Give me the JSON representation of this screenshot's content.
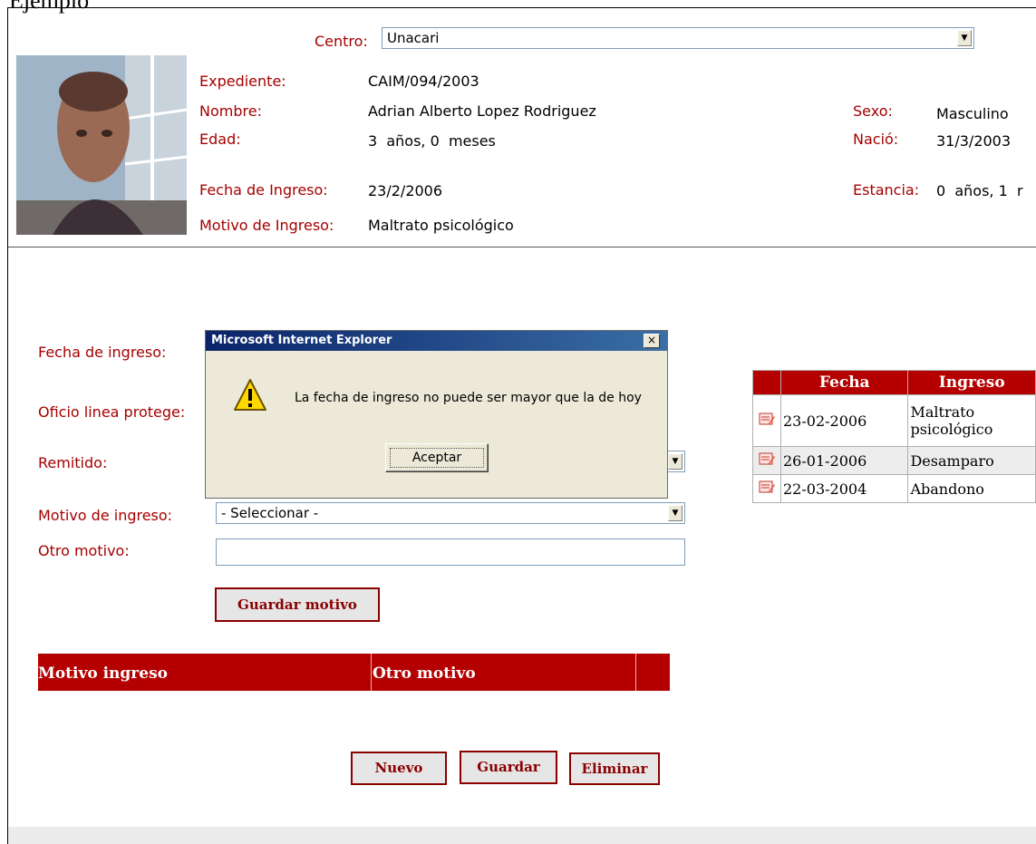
{
  "page": {
    "title_fragment": "Ejemplo"
  },
  "header": {
    "centro": {
      "label": "Centro:",
      "value": "Unacari"
    },
    "expediente": {
      "label": "Expediente:",
      "value": "CAIM/094/2003"
    },
    "nombre": {
      "label": "Nombre:",
      "value": "Adrian Alberto Lopez Rodriguez"
    },
    "edad": {
      "label": "Edad:",
      "value": "3  años, 0  meses"
    },
    "fecha_ingreso": {
      "label": "Fecha de Ingreso:",
      "value": "23/2/2006"
    },
    "motivo_ingreso": {
      "label": "Motivo de Ingreso:",
      "value": "Maltrato psicológico"
    },
    "sexo": {
      "label": "Sexo:",
      "value": "Masculino"
    },
    "nacio": {
      "label": "Nació:",
      "value": "31/3/2003"
    },
    "estancia": {
      "label": "Estancia:",
      "value": "0  años, 1  r"
    }
  },
  "form": {
    "fecha_ingreso_label": "Fecha de ingreso:",
    "oficio_label": "Oficio linea protege:",
    "remitido_label": "Remitido:",
    "motivo_label": "Motivo de ingreso:",
    "motivo_value": "- Seleccionar -",
    "otro_label": "Otro motivo:",
    "otro_value": "",
    "guardar_motivo": "Guardar motivo"
  },
  "motivo_table": {
    "headers": [
      "Motivo ingreso",
      "Otro motivo"
    ]
  },
  "actions": {
    "nuevo": "Nuevo",
    "guardar": "Guardar",
    "eliminar": "Eliminar"
  },
  "history": {
    "headers": {
      "fecha": "Fecha",
      "ingreso": "Ingreso"
    },
    "rows": [
      {
        "fecha": "23-02-2006",
        "ingreso_1": "Maltrato",
        "ingreso_2": "psicológico"
      },
      {
        "fecha": "26-01-2006",
        "ingreso": "Desamparo"
      },
      {
        "fecha": "22-03-2004",
        "ingreso": "Abandono"
      }
    ]
  },
  "dialog": {
    "title": "Microsoft Internet Explorer",
    "message": "La fecha de ingreso no puede ser mayor que la de hoy",
    "button": "Aceptar",
    "close_glyph": "×",
    "icon": "warning-icon"
  },
  "colors": {
    "label_red": "#a50000",
    "header_red": "#b40000",
    "dialog_bg": "#ece9d8",
    "titlebar": "#0a246a"
  }
}
